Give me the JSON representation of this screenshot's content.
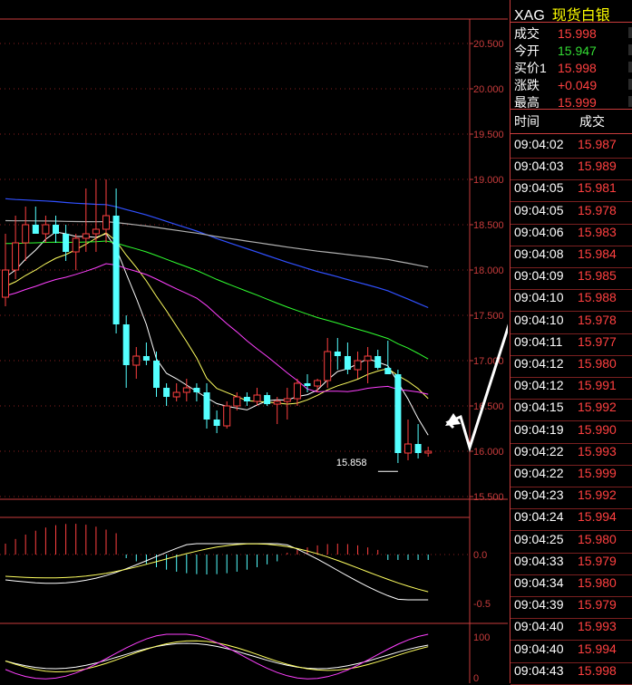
{
  "instrument": {
    "code": "XAG",
    "name": "现货白银"
  },
  "quote": [
    {
      "label": "成交",
      "value": "15.998",
      "color": "#ff4040"
    },
    {
      "label": "今开",
      "value": "15.947",
      "color": "#33dd33"
    },
    {
      "label": "买价1",
      "value": "15.998",
      "color": "#ff4040"
    },
    {
      "label": "涨跌",
      "value": "+0.049",
      "color": "#ff4040"
    },
    {
      "label": "最高",
      "value": "15.999",
      "color": "#ff4040"
    }
  ],
  "tick_header": {
    "time": "时间",
    "price": "成交"
  },
  "ticks": [
    {
      "time": "09:04:02",
      "price": "15.987"
    },
    {
      "time": "09:04:03",
      "price": "15.989"
    },
    {
      "time": "09:04:05",
      "price": "15.981"
    },
    {
      "time": "09:04:05",
      "price": "15.978"
    },
    {
      "time": "09:04:06",
      "price": "15.983"
    },
    {
      "time": "09:04:08",
      "price": "15.984"
    },
    {
      "time": "09:04:09",
      "price": "15.985"
    },
    {
      "time": "09:04:10",
      "price": "15.988"
    },
    {
      "time": "09:04:10",
      "price": "15.978"
    },
    {
      "time": "09:04:11",
      "price": "15.977"
    },
    {
      "time": "09:04:12",
      "price": "15.980"
    },
    {
      "time": "09:04:12",
      "price": "15.991"
    },
    {
      "time": "09:04:15",
      "price": "15.992"
    },
    {
      "time": "09:04:19",
      "price": "15.990"
    },
    {
      "time": "09:04:22",
      "price": "15.993"
    },
    {
      "time": "09:04:22",
      "price": "15.999"
    },
    {
      "time": "09:04:23",
      "price": "15.992"
    },
    {
      "time": "09:04:24",
      "price": "15.994"
    },
    {
      "time": "09:04:25",
      "price": "15.980"
    },
    {
      "time": "09:04:33",
      "price": "15.979"
    },
    {
      "time": "09:04:34",
      "price": "15.980"
    },
    {
      "time": "09:04:39",
      "price": "15.979"
    },
    {
      "time": "09:04:40",
      "price": "15.993"
    },
    {
      "time": "09:04:40",
      "price": "15.994"
    },
    {
      "time": "09:04:43",
      "price": "15.998"
    }
  ],
  "chart_data": {
    "type": "candlestick",
    "price_axis": {
      "ticks": [
        "20.500",
        "20.000",
        "19.500",
        "19.000",
        "18.500",
        "18.000",
        "17.500",
        "17.000",
        "16.500",
        "16.000",
        "15.500"
      ],
      "range": [
        15.5,
        20.5
      ]
    },
    "min_marker": "15.858",
    "candles": [
      {
        "o": 17.7,
        "h": 18.4,
        "l": 17.6,
        "c": 18.0
      },
      {
        "o": 18.0,
        "h": 18.6,
        "l": 17.9,
        "c": 18.3
      },
      {
        "o": 18.3,
        "h": 18.7,
        "l": 18.1,
        "c": 18.5
      },
      {
        "o": 18.5,
        "h": 18.7,
        "l": 18.4,
        "c": 18.4
      },
      {
        "o": 18.4,
        "h": 18.6,
        "l": 18.3,
        "c": 18.5
      },
      {
        "o": 18.5,
        "h": 18.6,
        "l": 18.3,
        "c": 18.4
      },
      {
        "o": 18.4,
        "h": 18.5,
        "l": 18.1,
        "c": 18.2
      },
      {
        "o": 18.2,
        "h": 18.4,
        "l": 18.0,
        "c": 18.35
      },
      {
        "o": 18.35,
        "h": 18.9,
        "l": 18.2,
        "c": 18.4
      },
      {
        "o": 18.4,
        "h": 19.0,
        "l": 18.2,
        "c": 18.45
      },
      {
        "o": 18.45,
        "h": 19.0,
        "l": 18.3,
        "c": 18.6
      },
      {
        "o": 18.6,
        "h": 18.9,
        "l": 17.3,
        "c": 17.4
      },
      {
        "o": 17.4,
        "h": 17.5,
        "l": 16.7,
        "c": 16.95
      },
      {
        "o": 16.95,
        "h": 17.15,
        "l": 16.8,
        "c": 17.05
      },
      {
        "o": 17.05,
        "h": 17.2,
        "l": 16.95,
        "c": 17.0
      },
      {
        "o": 17.0,
        "h": 17.1,
        "l": 16.6,
        "c": 16.7
      },
      {
        "o": 16.7,
        "h": 16.75,
        "l": 16.5,
        "c": 16.6
      },
      {
        "o": 16.6,
        "h": 16.75,
        "l": 16.55,
        "c": 16.65
      },
      {
        "o": 16.65,
        "h": 16.8,
        "l": 16.55,
        "c": 16.7
      },
      {
        "o": 16.7,
        "h": 16.75,
        "l": 16.55,
        "c": 16.65
      },
      {
        "o": 16.65,
        "h": 16.75,
        "l": 16.25,
        "c": 16.35
      },
      {
        "o": 16.35,
        "h": 16.45,
        "l": 16.2,
        "c": 16.28
      },
      {
        "o": 16.28,
        "h": 16.55,
        "l": 16.25,
        "c": 16.5
      },
      {
        "o": 16.5,
        "h": 16.65,
        "l": 16.45,
        "c": 16.6
      },
      {
        "o": 16.6,
        "h": 16.65,
        "l": 16.5,
        "c": 16.55
      },
      {
        "o": 16.55,
        "h": 16.7,
        "l": 16.5,
        "c": 16.62
      },
      {
        "o": 16.62,
        "h": 16.65,
        "l": 16.5,
        "c": 16.52
      },
      {
        "o": 16.52,
        "h": 16.6,
        "l": 16.3,
        "c": 16.55
      },
      {
        "o": 16.55,
        "h": 16.7,
        "l": 16.35,
        "c": 16.58
      },
      {
        "o": 16.58,
        "h": 16.8,
        "l": 16.5,
        "c": 16.75
      },
      {
        "o": 16.75,
        "h": 16.85,
        "l": 16.65,
        "c": 16.72
      },
      {
        "o": 16.72,
        "h": 16.8,
        "l": 16.65,
        "c": 16.78
      },
      {
        "o": 16.78,
        "h": 17.25,
        "l": 16.7,
        "c": 17.1
      },
      {
        "o": 17.1,
        "h": 17.25,
        "l": 16.9,
        "c": 17.05
      },
      {
        "o": 17.05,
        "h": 17.2,
        "l": 16.85,
        "c": 16.9
      },
      {
        "o": 16.9,
        "h": 17.1,
        "l": 16.8,
        "c": 17.0
      },
      {
        "o": 17.0,
        "h": 17.15,
        "l": 16.75,
        "c": 17.05
      },
      {
        "o": 17.05,
        "h": 17.12,
        "l": 16.9,
        "c": 16.92
      },
      {
        "o": 16.92,
        "h": 17.22,
        "l": 16.85,
        "c": 16.85
      },
      {
        "o": 16.85,
        "h": 16.9,
        "l": 15.87,
        "c": 15.98
      },
      {
        "o": 15.98,
        "h": 16.35,
        "l": 15.9,
        "c": 16.08
      },
      {
        "o": 16.08,
        "h": 16.3,
        "l": 15.92,
        "c": 15.98
      },
      {
        "o": 15.98,
        "h": 16.05,
        "l": 15.94,
        "c": 16.0
      }
    ]
  }
}
